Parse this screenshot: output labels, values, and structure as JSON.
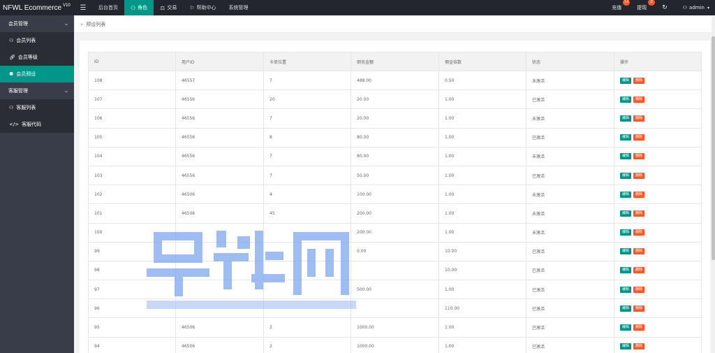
{
  "app": {
    "brand": "NFWL Ecommerce",
    "version": "V10"
  },
  "topnav": {
    "menu_icon": "hamburger-icon",
    "items": [
      {
        "label": "后台首页",
        "icon": ""
      },
      {
        "label": "角色",
        "icon": "user-icon",
        "active": true
      },
      {
        "label": "交易",
        "icon": "scale-icon"
      },
      {
        "label": "帮助中心",
        "icon": "flag-icon"
      },
      {
        "label": "系统管理",
        "icon": ""
      }
    ],
    "right": {
      "recharge_label": "充值",
      "recharge_badge": "14",
      "withdraw_label": "提现",
      "withdraw_badge": "0",
      "refresh_icon": "refresh-icon",
      "admin_label": "admin"
    }
  },
  "sidebar": {
    "groups": [
      {
        "label": "会员管理",
        "items": [
          {
            "label": "会员列表",
            "icon": "user-icon"
          },
          {
            "label": "会员等级",
            "icon": "link-icon"
          },
          {
            "label": "会员预设",
            "icon": "group-icon",
            "active": true
          }
        ]
      },
      {
        "label": "客服管理",
        "items": [
          {
            "label": "客服列表",
            "icon": "users-icon"
          },
          {
            "label": "客服代码",
            "icon": "code-icon"
          }
        ]
      }
    ]
  },
  "breadcrumb": {
    "separator": "»",
    "current": "预设列表"
  },
  "table": {
    "headers": [
      "ID",
      "用户ID",
      "卡单位置",
      "倒充金额",
      "佣金倍数",
      "状态",
      "操作"
    ],
    "edit_label": "编辑",
    "delete_label": "删除",
    "rows": [
      [
        "108",
        "46557",
        "7",
        "488.00",
        "0.50",
        "未激活"
      ],
      [
        "107",
        "46556",
        "20",
        "20.00",
        "1.00",
        "已激活"
      ],
      [
        "106",
        "46556",
        "7",
        "20.00",
        "1.00",
        "未激活"
      ],
      [
        "105",
        "46556",
        "8",
        "80.00",
        "1.00",
        "已激活"
      ],
      [
        "104",
        "46556",
        "7",
        "80.00",
        "1.00",
        "未激活"
      ],
      [
        "103",
        "46556",
        "7",
        "50.00",
        "1.00",
        "已激活"
      ],
      [
        "102",
        "46506",
        "4",
        "100.00",
        "1.00",
        "未激活"
      ],
      [
        "101",
        "46506",
        "45",
        "200.00",
        "1.00",
        "未激活"
      ],
      [
        "100",
        "",
        "",
        "200.00",
        "1.00",
        "未激活"
      ],
      [
        "99",
        "",
        "",
        "0.00",
        "10.00",
        "已激活"
      ],
      [
        "98",
        "",
        "",
        "",
        "10.00",
        "已激活"
      ],
      [
        "97",
        "",
        "",
        "500.00",
        "1.00",
        "已激活"
      ],
      [
        "96",
        "",
        "",
        "",
        "110.00",
        "已激活"
      ],
      [
        "95",
        "46506",
        "2",
        "1000.00",
        "1.00",
        "已激活"
      ],
      [
        "94",
        "46506",
        "2",
        "1000.00",
        "1.00",
        "已激活"
      ]
    ]
  },
  "colors": {
    "topbar": "#23262e",
    "sidebar": "#393d49",
    "accent": "#009688",
    "danger": "#ff5722"
  }
}
